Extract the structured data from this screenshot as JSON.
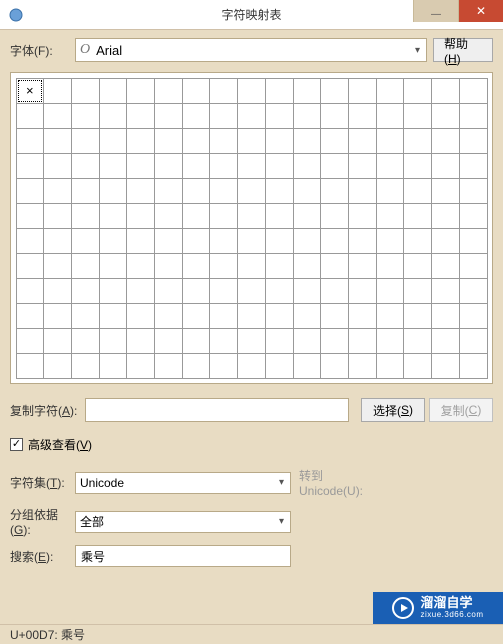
{
  "window": {
    "title": "字符映射表"
  },
  "toolbar": {
    "font_label": "字体(F):",
    "font_name": "Arial",
    "font_prefix": "O",
    "help_label": "帮助(H)"
  },
  "grid": {
    "selected_char": "×"
  },
  "copy": {
    "label": "复制字符(A):",
    "value": "",
    "select_btn": "选择(S)",
    "copy_btn": "复制(C)"
  },
  "advanced": {
    "label": "高级查看(V)"
  },
  "charset": {
    "label": "字符集(T):",
    "value": "Unicode",
    "side_label": "转到",
    "side_sub": "Unicode(U):"
  },
  "group": {
    "label": "分组依据(G):",
    "value": "全部"
  },
  "search": {
    "label": "搜索(E):",
    "value": "乘号"
  },
  "status": {
    "text": "U+00D7: 乘号"
  },
  "branding": {
    "name": "溜溜自学",
    "url": "zixue.3d66.com"
  }
}
